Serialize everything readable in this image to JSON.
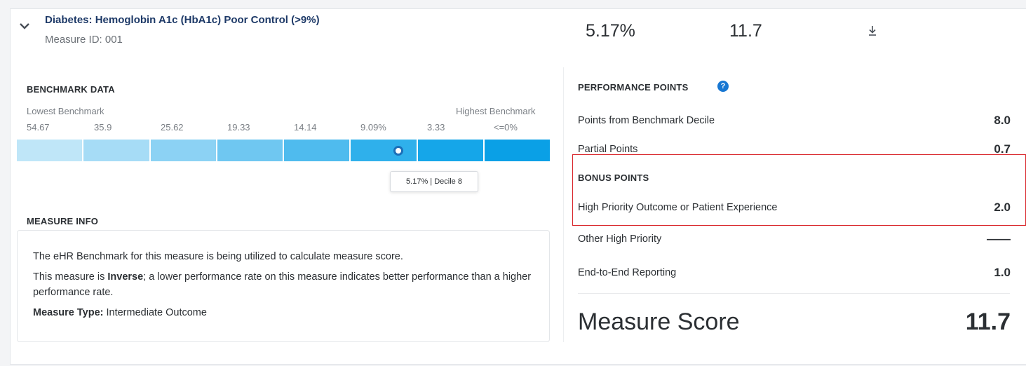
{
  "measure": {
    "title": "Diabetes: Hemoglobin A1c (HbA1c) Poor Control (>9%)",
    "id_text": "Measure ID: 001",
    "performance_rate": "5.17%",
    "score": "11.7"
  },
  "benchmark": {
    "section_label": "BENCHMARK DATA",
    "lowest_label": "Lowest Benchmark",
    "highest_label": "Highest Benchmark",
    "ticks": [
      "54.67",
      "35.9",
      "25.62",
      "19.33",
      "14.14",
      "9.09%",
      "3.33",
      "<=0%"
    ],
    "segment_colors": [
      "#bfe6f8",
      "#a6dcf6",
      "#8cd2f4",
      "#6fc7f1",
      "#4fbbee",
      "#2fb0eb",
      "#15a6e9",
      "#0aa0e6"
    ],
    "tooltip": "5.17% | Decile 8"
  },
  "measure_info": {
    "section_label": "MEASURE INFO",
    "line1": "The eHR Benchmark for this measure is being utilized to calculate measure score.",
    "line2_prefix": "This measure is ",
    "line2_bold": "Inverse",
    "line2_suffix": "; a lower performance rate on this measure indicates better performance than a higher performance rate.",
    "type_label": "Measure Type:",
    "type_value": " Intermediate Outcome"
  },
  "performance_points": {
    "section_label": "PERFORMANCE POINTS",
    "rows": [
      {
        "label": "Points from Benchmark Decile",
        "value": "8.0"
      },
      {
        "label": "Partial Points",
        "value": "0.7"
      }
    ],
    "bonus_label": "BONUS POINTS",
    "bonus_rows": [
      {
        "label": "High Priority Outcome or Patient Experience",
        "value": "2.0"
      },
      {
        "label": "Other High Priority",
        "value": "——"
      },
      {
        "label": "End-to-End Reporting",
        "value": "1.0"
      }
    ],
    "score_label": "Measure Score",
    "score_value": "11.7"
  },
  "icons": {
    "collapse": "chevron-down-icon",
    "download": "download-icon",
    "help": "help-icon"
  },
  "colors": {
    "title": "#1e3a68",
    "highlight_border": "#d9262b",
    "help": "#1877d2"
  }
}
